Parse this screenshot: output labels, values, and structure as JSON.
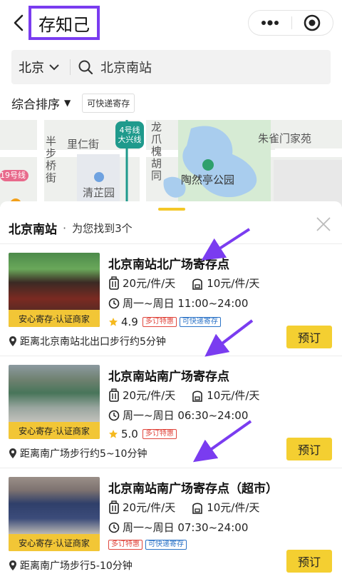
{
  "header": {
    "title": "存知己",
    "back_icon": "back-arrow-icon",
    "more_icon": "more-dots-icon",
    "target_icon": "target-circle-icon"
  },
  "search": {
    "city": "北京",
    "query": "北京南站"
  },
  "filters": {
    "sort_label": "综合排序",
    "sort_arrow": "▼",
    "chip": "可快递寄存"
  },
  "map": {
    "labels": {
      "yishou": "陶然亭",
      "line4": "4号线",
      "daxing": "大兴线",
      "longzhao": "龙爪槐胡同",
      "zhuque": "朱雀门家苑",
      "banbu": "半步桥街",
      "liren": "里仁街",
      "qingzhi": "清芷园",
      "park": "陶然亭公园",
      "line19": "19号线"
    }
  },
  "sheet": {
    "title": "北京南站",
    "dot": "·",
    "count_text": "为您找到3个"
  },
  "colors": {
    "accent": "#f4cf31",
    "highlight_box": "#7a3cf0",
    "tag_red": "#e0463d",
    "tag_blue": "#2b73c7"
  },
  "items": [
    {
      "name": "北京南站北广场寄存点",
      "price_bag": "20元/件/天",
      "price_backpack": "10元/件/天",
      "hours": "周一~周日 11:00~24:00",
      "rating": "4.9",
      "tags": [
        "多订特惠",
        "可快递寄存"
      ],
      "badge": "安心寄存·认证商家",
      "distance": "距离北京南站北出口步行约5分钟",
      "book": "预订"
    },
    {
      "name": "北京南站南广场寄存点",
      "price_bag": "20元/件/天",
      "price_backpack": "10元/件/天",
      "hours": "周一~周日 06:30~24:00",
      "rating": "5.0",
      "tags": [
        "多订特惠"
      ],
      "badge": "安心寄存·认证商家",
      "distance": "距离南广场步行约5~10分钟",
      "book": "预订"
    },
    {
      "name": "北京南站南广场寄存点（超市）",
      "price_bag": "20元/件/天",
      "price_backpack": "10元/件/天",
      "hours": "周一~周日 07:30~24:00",
      "tags": [
        "多订特惠",
        "可快递寄存"
      ],
      "badge": "安心寄存·认证商家",
      "distance": "距离南广场步行5-10分钟",
      "book": "预订"
    }
  ]
}
